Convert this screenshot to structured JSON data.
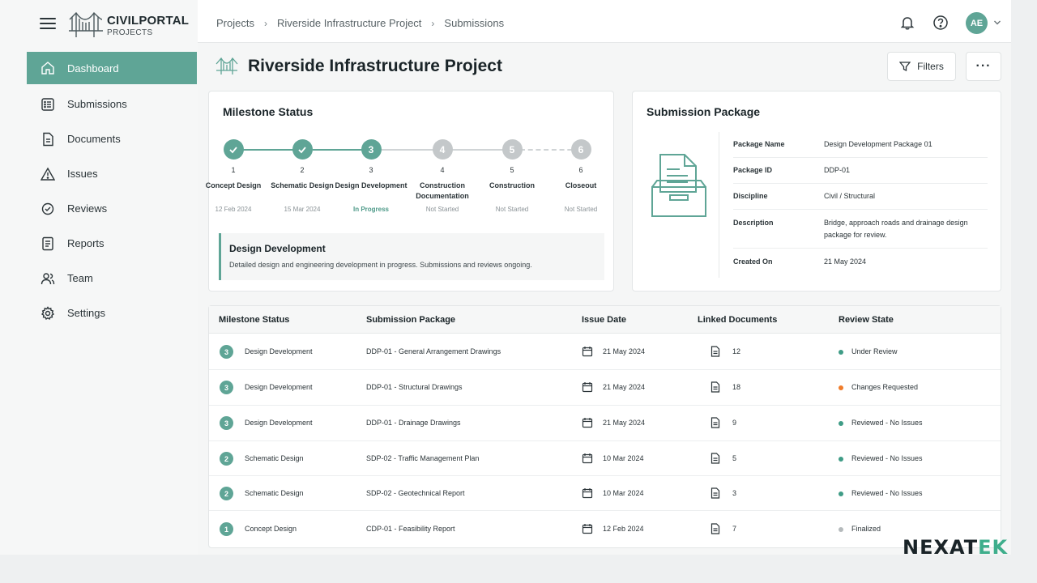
{
  "brand": {
    "name": "CIVILPORTAL",
    "sub": "PROJECTS"
  },
  "sidebar": {
    "items": [
      {
        "label": "Dashboard",
        "icon": "home-icon"
      },
      {
        "label": "Submissions",
        "icon": "submissions-icon"
      },
      {
        "label": "Documents",
        "icon": "document-icon"
      },
      {
        "label": "Issues",
        "icon": "warning-icon"
      },
      {
        "label": "Reviews",
        "icon": "review-icon"
      },
      {
        "label": "Reports",
        "icon": "report-icon"
      },
      {
        "label": "Team",
        "icon": "team-icon"
      },
      {
        "label": "Settings",
        "icon": "gear-icon"
      }
    ]
  },
  "header": {
    "breadcrumbs": [
      "Projects",
      "Riverside Infrastructure Project",
      "Submissions"
    ],
    "avatar_initials": "AE"
  },
  "page": {
    "title": "Riverside Infrastructure Project",
    "filters_label": "Filters",
    "more_label": "···"
  },
  "milestones": {
    "title": "Milestone Status",
    "steps": [
      {
        "number": "1",
        "name": "Concept Design",
        "date": "12 Feb 2024",
        "state": "complete"
      },
      {
        "number": "2",
        "name": "Schematic Design",
        "date": "15 Mar 2024",
        "state": "complete"
      },
      {
        "number": "3",
        "name": "Design Development",
        "date": "In Progress",
        "state": "current"
      },
      {
        "number": "4",
        "name": "Construction Documentation",
        "date": "Not Started",
        "state": "pending"
      },
      {
        "number": "5",
        "name": "Construction",
        "date": "Not Started",
        "state": "pending"
      },
      {
        "number": "6",
        "name": "Closeout",
        "date": "Not Started",
        "state": "pending"
      }
    ],
    "current_title": "Design Development",
    "current_text": "Detailed design and engineering development in progress. Submissions and reviews ongoing."
  },
  "package": {
    "title": "Submission Package",
    "rows": [
      {
        "label": "Package Name",
        "value": "Design Development Package 01"
      },
      {
        "label": "Package ID",
        "value": "DDP-01"
      },
      {
        "label": "Discipline",
        "value": "Civil / Structural"
      },
      {
        "label": "Description",
        "value": "Bridge, approach roads and drainage design package for review."
      },
      {
        "label": "Created On",
        "value": "21 May 2024"
      }
    ]
  },
  "table": {
    "headers": [
      "Milestone Status",
      "Submission Package",
      "Issue Date",
      "Linked Documents",
      "Review State"
    ],
    "rows": [
      {
        "badge": "3",
        "milestone": "Design Development",
        "package": "DDP-01 - General Arrangement Drawings",
        "date": "21 May 2024",
        "docs": "12",
        "state": "Under Review",
        "state_color": "#3f9c86"
      },
      {
        "badge": "3",
        "milestone": "Design Development",
        "package": "DDP-01 - Structural Drawings",
        "date": "21 May 2024",
        "docs": "18",
        "state": "Changes Requested",
        "state_color": "#f07c2a"
      },
      {
        "badge": "3",
        "milestone": "Design Development",
        "package": "DDP-01 - Drainage Drawings",
        "date": "21 May 2024",
        "docs": "9",
        "state": "Reviewed - No Issues",
        "state_color": "#3f9c86"
      },
      {
        "badge": "2",
        "milestone": "Schematic Design",
        "package": "SDP-02 - Traffic Management Plan",
        "date": "10 Mar 2024",
        "docs": "5",
        "state": "Reviewed - No Issues",
        "state_color": "#3f9c86"
      },
      {
        "badge": "2",
        "milestone": "Schematic Design",
        "package": "SDP-02 - Geotechnical Report",
        "date": "10 Mar 2024",
        "docs": "3",
        "state": "Reviewed - No Issues",
        "state_color": "#3f9c86"
      },
      {
        "badge": "1",
        "milestone": "Concept Design",
        "package": "CDP-01 - Feasibility Report",
        "date": "12 Feb 2024",
        "docs": "7",
        "state": "Finalized",
        "state_color": "#b5babc"
      }
    ]
  },
  "watermark": {
    "text_a": "NEXAT",
    "text_b": "EK"
  },
  "colors": {
    "accent": "#5fa596",
    "pending": "#c4c8ca"
  }
}
